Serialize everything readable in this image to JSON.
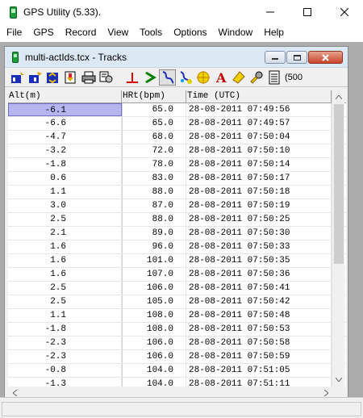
{
  "window": {
    "title": "GPS Utility (5.33)."
  },
  "menu": [
    "File",
    "GPS",
    "Record",
    "View",
    "Tools",
    "Options",
    "Window",
    "Help"
  ],
  "child": {
    "title": "multi-actIds.tcx - Tracks"
  },
  "toolbar": {
    "overflow_text": "(500"
  },
  "columns": {
    "alt": "Alt(m)",
    "hr": "HRt(bpm)",
    "time": "Time (UTC)"
  },
  "rows": [
    {
      "alt": "-6.1",
      "hr": "65.0",
      "time": "28-08-2011 07:49:56"
    },
    {
      "alt": "-6.6",
      "hr": "65.0",
      "time": "28-08-2011 07:49:57"
    },
    {
      "alt": "-4.7",
      "hr": "68.0",
      "time": "28-08-2011 07:50:04"
    },
    {
      "alt": "-3.2",
      "hr": "72.0",
      "time": "28-08-2011 07:50:10"
    },
    {
      "alt": "-1.8",
      "hr": "78.0",
      "time": "28-08-2011 07:50:14"
    },
    {
      "alt": "0.6",
      "hr": "83.0",
      "time": "28-08-2011 07:50:17"
    },
    {
      "alt": "1.1",
      "hr": "88.0",
      "time": "28-08-2011 07:50:18"
    },
    {
      "alt": "3.0",
      "hr": "87.0",
      "time": "28-08-2011 07:50:19"
    },
    {
      "alt": "2.5",
      "hr": "88.0",
      "time": "28-08-2011 07:50:25"
    },
    {
      "alt": "2.1",
      "hr": "89.0",
      "time": "28-08-2011 07:50:30"
    },
    {
      "alt": "1.6",
      "hr": "96.0",
      "time": "28-08-2011 07:50:33"
    },
    {
      "alt": "1.6",
      "hr": "101.0",
      "time": "28-08-2011 07:50:35"
    },
    {
      "alt": "1.6",
      "hr": "107.0",
      "time": "28-08-2011 07:50:36"
    },
    {
      "alt": "2.5",
      "hr": "106.0",
      "time": "28-08-2011 07:50:41"
    },
    {
      "alt": "2.5",
      "hr": "105.0",
      "time": "28-08-2011 07:50:42"
    },
    {
      "alt": "1.1",
      "hr": "108.0",
      "time": "28-08-2011 07:50:48"
    },
    {
      "alt": "-1.8",
      "hr": "108.0",
      "time": "28-08-2011 07:50:53"
    },
    {
      "alt": "-2.3",
      "hr": "106.0",
      "time": "28-08-2011 07:50:58"
    },
    {
      "alt": "-2.3",
      "hr": "106.0",
      "time": "28-08-2011 07:50:59"
    },
    {
      "alt": "-0.8",
      "hr": "104.0",
      "time": "28-08-2011 07:51:05"
    },
    {
      "alt": "-1.3",
      "hr": "104.0",
      "time": "28-08-2011 07:51:11"
    }
  ],
  "selected_row": 0
}
